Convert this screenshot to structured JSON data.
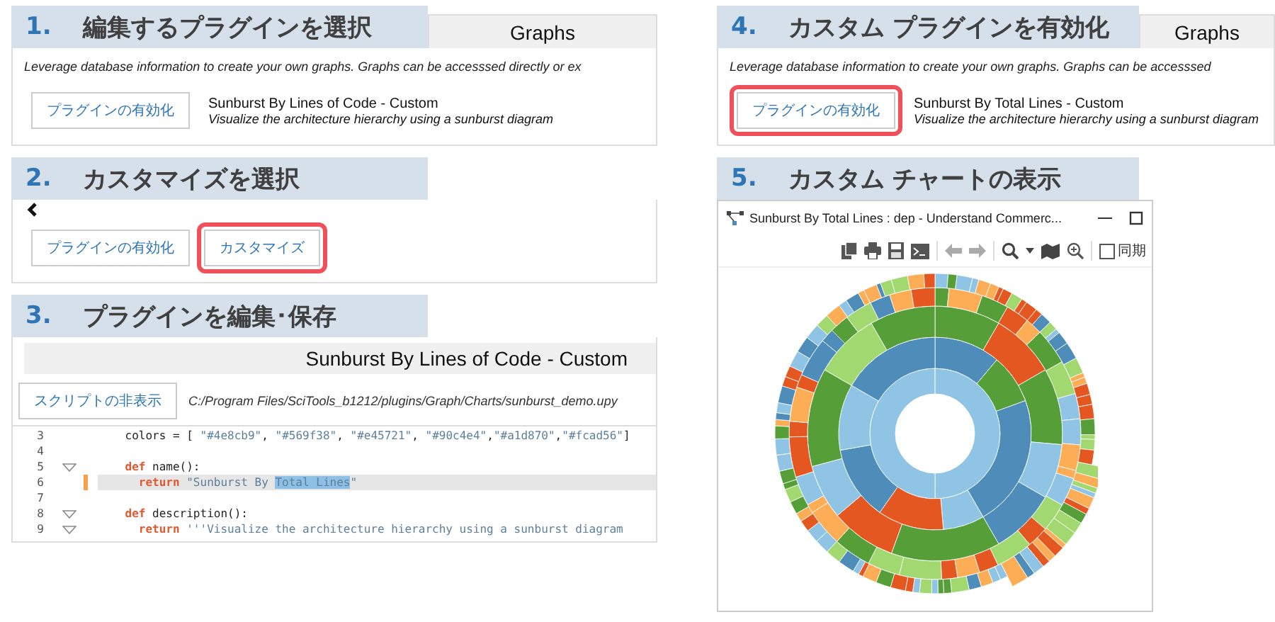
{
  "left_column": [
    {
      "number": "1.",
      "title": "編集するプラグインを選択",
      "panel": {
        "kind": "plugin_list",
        "header": "Graphs",
        "description": "Leverage database information to create your own graphs. Graphs can be accesssed directly or ex",
        "plugins": [
          {
            "button": "プラグインの有効化",
            "highlighted": false,
            "name": "Sunburst By Lines of Code - Custom",
            "summary": "Visualize the architecture hierarchy using a sunburst diagram"
          }
        ]
      }
    },
    {
      "number": "2.",
      "title": "カスタマイズを選択",
      "panel": {
        "kind": "plugin_actions",
        "buttons": [
          {
            "label": "プラグインの有効化",
            "highlighted": false
          },
          {
            "label": "カスタマイズ",
            "highlighted": true
          }
        ]
      }
    },
    {
      "number": "3.",
      "title": "プラグインを編集･保存",
      "panel": {
        "kind": "script_editor",
        "header": "Sunburst By Lines of Code - Custom",
        "button": "スクリプトの非表示",
        "path": "C:/Program Files/SciTools_b1212/plugins/Graph/Charts/sunburst_demo.upy",
        "lines": [
          {
            "number": "3",
            "fold": false,
            "current": false,
            "changed": false,
            "tokens": [
              {
                "kind": "plain",
                "text": "    colors = [ "
              },
              {
                "kind": "str",
                "text": "\"#4e8cb9\""
              },
              {
                "kind": "plain",
                "text": ", "
              },
              {
                "kind": "str",
                "text": "\"#569f38\""
              },
              {
                "kind": "plain",
                "text": ", "
              },
              {
                "kind": "str",
                "text": "\"#e45721\""
              },
              {
                "kind": "plain",
                "text": ", "
              },
              {
                "kind": "str",
                "text": "\"#90c4e4\""
              },
              {
                "kind": "plain",
                "text": ","
              },
              {
                "kind": "str",
                "text": "\"#a1d870\""
              },
              {
                "kind": "plain",
                "text": ","
              },
              {
                "kind": "str",
                "text": "\"#fcad56\""
              },
              {
                "kind": "plain",
                "text": "]"
              }
            ]
          },
          {
            "number": "4",
            "fold": false,
            "current": false,
            "changed": false
          },
          {
            "number": "5",
            "fold": true,
            "current": false,
            "changed": false,
            "tokens": [
              {
                "kind": "kw",
                "text": "    def"
              },
              {
                "kind": "plain",
                "text": " name():"
              }
            ]
          },
          {
            "number": "6",
            "fold": false,
            "current": true,
            "changed": true,
            "tokens": [
              {
                "kind": "kw",
                "text": "      return"
              },
              {
                "kind": "str",
                "text": " \"Sunburst By "
              },
              {
                "kind": "sel",
                "text": "Total Lines"
              },
              {
                "kind": "str",
                "text": "\""
              }
            ]
          },
          {
            "number": "7",
            "fold": false,
            "current": false,
            "changed": false
          },
          {
            "number": "8",
            "fold": true,
            "current": false,
            "changed": false,
            "tokens": [
              {
                "kind": "kw",
                "text": "    def"
              },
              {
                "kind": "plain",
                "text": " description():"
              }
            ]
          },
          {
            "number": "9",
            "fold": true,
            "current": false,
            "changed": false,
            "tokens": [
              {
                "kind": "kw",
                "text": "      return"
              },
              {
                "kind": "str",
                "text": " '''Visualize the architecture hierarchy using a sunburst diagram"
              }
            ]
          }
        ]
      }
    }
  ],
  "right_column": [
    {
      "number": "4.",
      "title": "カスタム プラグインを有効化",
      "panel": {
        "kind": "plugin_list",
        "header": "Graphs",
        "description": "Leverage database information to create your own graphs. Graphs can be accesssed",
        "plugins": [
          {
            "button": "プラグインの有効化",
            "highlighted": true,
            "name": "Sunburst By Total Lines - Custom",
            "summary": "Visualize the architecture hierarchy using a sunburst diagram"
          }
        ]
      }
    },
    {
      "number": "5.",
      "title": "カスタム チャートの表示",
      "panel": {
        "kind": "chart_window",
        "window_title": "Sunburst By Total Lines : dep - Understand Commerc...",
        "sync": {
          "label": "同期",
          "checked": false
        }
      }
    }
  ]
}
